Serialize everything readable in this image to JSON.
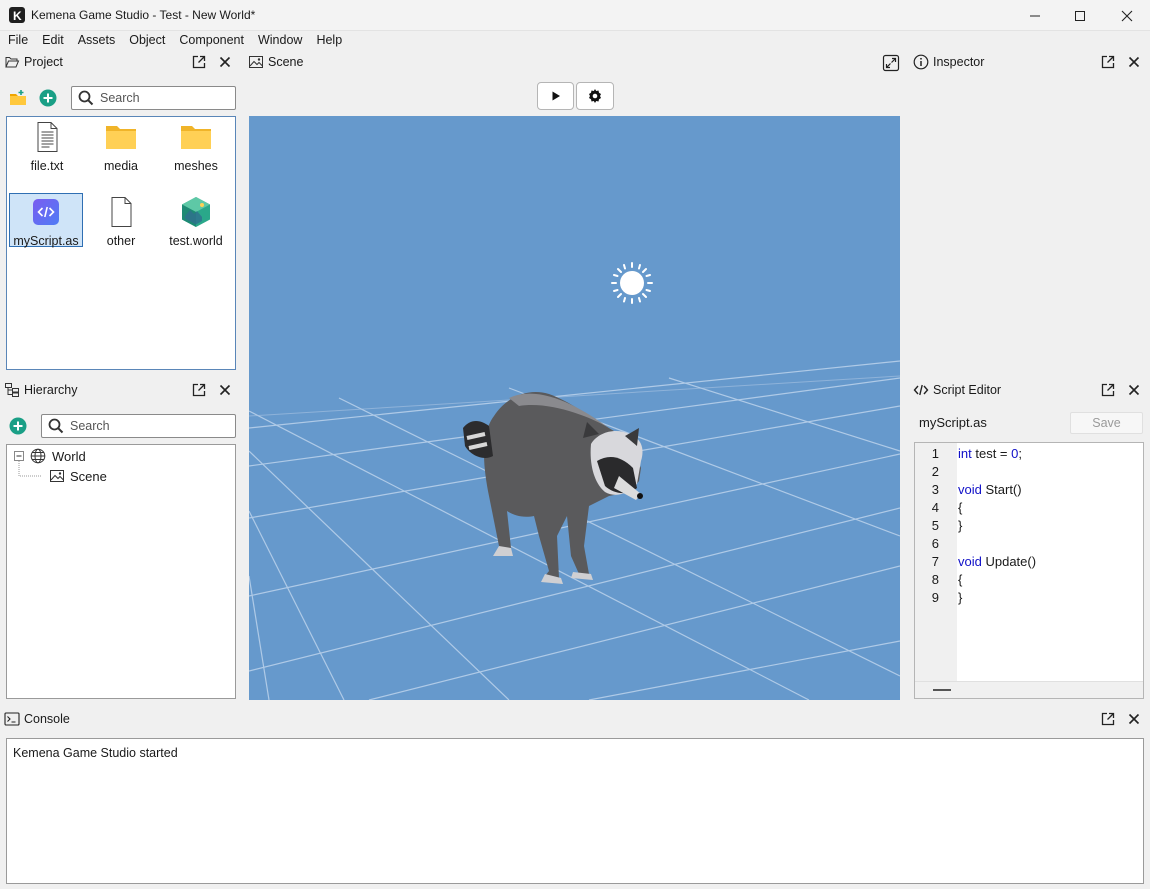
{
  "window": {
    "title": "Kemena Game Studio - Test - New World*",
    "logo_letter": "K"
  },
  "menu": [
    "File",
    "Edit",
    "Assets",
    "Object",
    "Component",
    "Window",
    "Help"
  ],
  "project": {
    "title": "Project",
    "search_placeholder": "Search",
    "files": [
      {
        "name": "file.txt",
        "icon": "text-file-icon"
      },
      {
        "name": "media",
        "icon": "folder-icon"
      },
      {
        "name": "meshes",
        "icon": "folder-icon"
      },
      {
        "name": "myScript.as",
        "icon": "script-file-icon",
        "selected": true
      },
      {
        "name": "other",
        "icon": "blank-file-icon"
      },
      {
        "name": "test.world",
        "icon": "world-file-icon"
      }
    ]
  },
  "hierarchy": {
    "title": "Hierarchy",
    "search_placeholder": "Search",
    "root": "World",
    "child": "Scene"
  },
  "scene": {
    "title": "Scene",
    "background": "#6699cc"
  },
  "inspector": {
    "title": "Inspector"
  },
  "script_editor": {
    "title": "Script Editor",
    "file_name": "myScript.as",
    "save_label": "Save",
    "lines": [
      {
        "n": "1",
        "code": [
          {
            "t": "int",
            "k": "kw"
          },
          {
            "t": " test = "
          },
          {
            "t": "0",
            "k": "num"
          },
          {
            "t": ";"
          }
        ]
      },
      {
        "n": "2",
        "code": []
      },
      {
        "n": "3",
        "code": [
          {
            "t": "void",
            "k": "kw"
          },
          {
            "t": " Start()"
          }
        ]
      },
      {
        "n": "4",
        "code": [
          {
            "t": "{"
          }
        ]
      },
      {
        "n": "5",
        "code": [
          {
            "t": "}"
          }
        ]
      },
      {
        "n": "6",
        "code": []
      },
      {
        "n": "7",
        "code": [
          {
            "t": "void",
            "k": "kw"
          },
          {
            "t": " Update()"
          }
        ]
      },
      {
        "n": "8",
        "code": [
          {
            "t": "{"
          }
        ]
      },
      {
        "n": "9",
        "code": [
          {
            "t": "}"
          }
        ]
      }
    ]
  },
  "console": {
    "title": "Console",
    "messages": [
      "Kemena Game Studio started"
    ]
  },
  "colors": {
    "accent": "#1a9f86",
    "selection": "#cfe4f8",
    "keyword": "#1010c8"
  }
}
